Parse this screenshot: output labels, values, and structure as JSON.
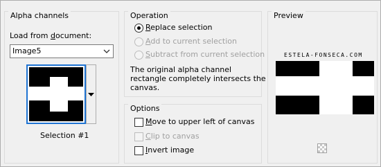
{
  "alpha": {
    "title": "Alpha channels",
    "load_label_pre": "Load from ",
    "load_label_u": "d",
    "load_label_post": "ocument:",
    "document_value": "Image5",
    "selection_caption": "Selection #1"
  },
  "operation": {
    "title": "Operation",
    "replace": {
      "u": "R",
      "rest": "eplace selection"
    },
    "add": {
      "u": "A",
      "rest": "dd to current selection"
    },
    "subtract": {
      "u": "S",
      "rest": "ubtract from current selection"
    },
    "info_line1": "The original alpha channel",
    "info_line2": "rectangle completely intersects the",
    "info_line3": "canvas."
  },
  "options": {
    "title": "Options",
    "move": {
      "u": "M",
      "rest": "ove to upper left of canvas"
    },
    "clip": {
      "u": "C",
      "rest": "lip to canvas"
    },
    "invert": {
      "u": "I",
      "rest": "nvert image"
    }
  },
  "preview": {
    "title": "Preview",
    "watermark": "ESTELA-FONSECA.COM"
  },
  "colors": {
    "selection_border": "#1e73d2",
    "mask_black": "#000000",
    "mask_white": "#ffffff"
  }
}
